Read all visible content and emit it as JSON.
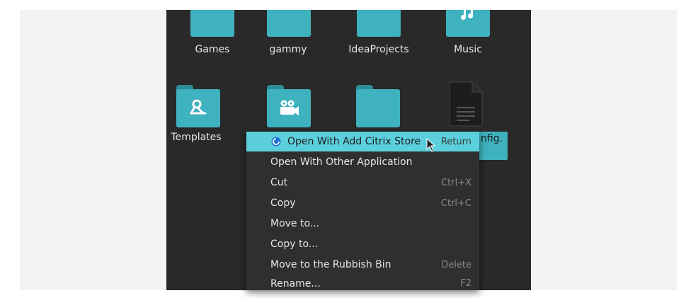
{
  "files": {
    "games": "Games",
    "gammy": "gammy",
    "ideaprojects": "IdeaProjects",
    "music": "Music",
    "templates": "Templates",
    "selected_file_partial": "nfig."
  },
  "context_menu": {
    "items": [
      {
        "label": "Open With Add Citrix Store",
        "shortcut": "Return"
      },
      {
        "label": "Open With Other Application",
        "shortcut": ""
      },
      {
        "label": "Cut",
        "shortcut": "Ctrl+X"
      },
      {
        "label": "Copy",
        "shortcut": "Ctrl+C"
      },
      {
        "label": "Move to...",
        "shortcut": ""
      },
      {
        "label": "Copy to...",
        "shortcut": ""
      },
      {
        "label": "Move to the Rubbish Bin",
        "shortcut": "Delete"
      },
      {
        "label": "Rename...",
        "shortcut": "F2"
      }
    ]
  },
  "colors": {
    "viewport_background": "#292929",
    "folder": "#3fb2bf",
    "menu_highlight": "#5bd0dc",
    "menu_background": "#2f2f2f"
  },
  "icons": {
    "music_emblem": "music-note-icon",
    "templates_emblem": "template-icon",
    "videos_emblem": "video-camera-icon",
    "document": "text-document-icon",
    "citrix": "citrix-icon",
    "cursor": "mouse-pointer-icon"
  }
}
